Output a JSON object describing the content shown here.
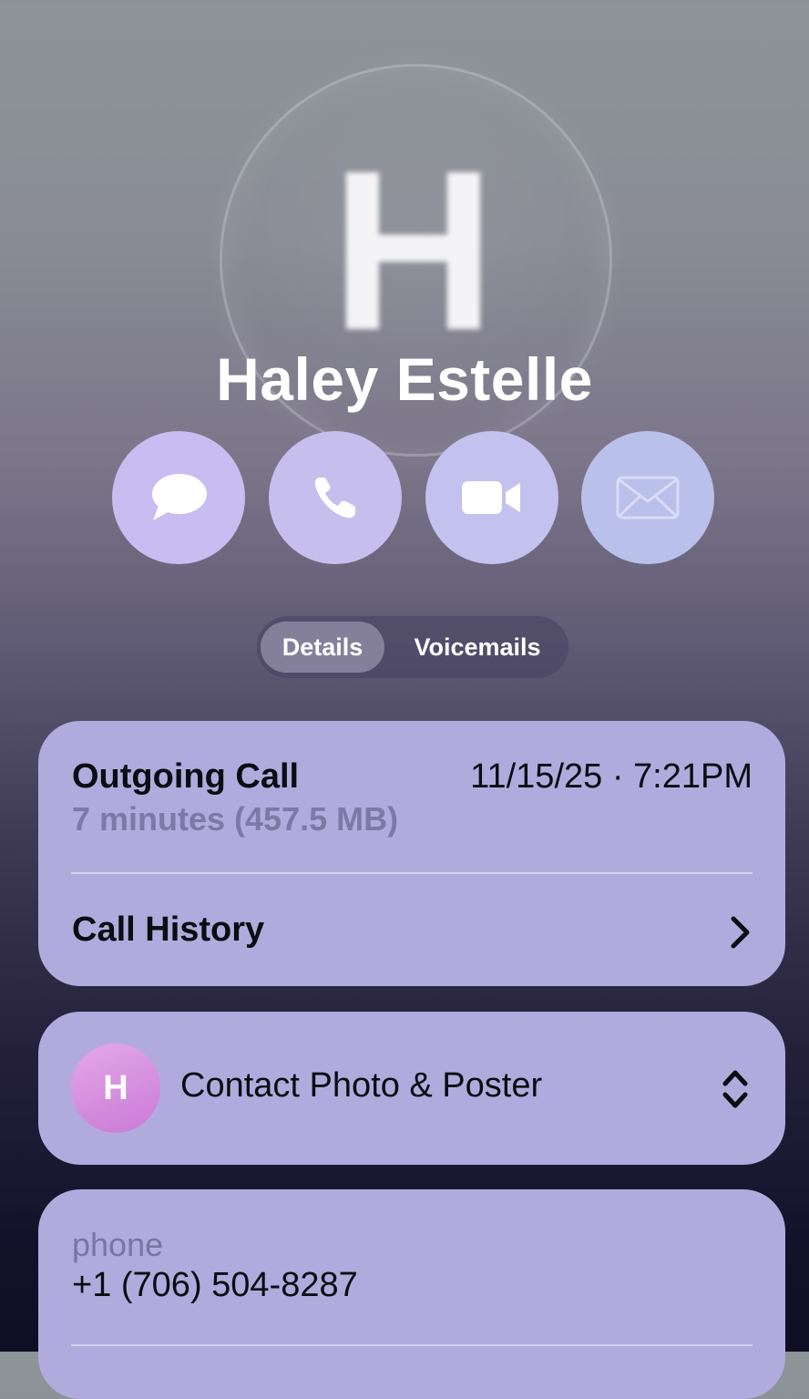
{
  "contact": {
    "monogram": "H",
    "name": "Haley Estelle"
  },
  "actions": [
    {
      "icon": "message-bubble-icon",
      "label": "message"
    },
    {
      "icon": "phone-icon",
      "label": "call"
    },
    {
      "icon": "video-camera-icon",
      "label": "video"
    },
    {
      "icon": "mail-icon",
      "label": "mail"
    }
  ],
  "tabs": {
    "details": "Details",
    "voicemails": "Voicemails",
    "selected": "Details"
  },
  "recent_call": {
    "type": "Outgoing Call",
    "datetime": "11/15/25 · 7:21PM",
    "detail": "7 minutes (457.5 MB)"
  },
  "call_history": {
    "label": "Call History"
  },
  "contact_photo": {
    "avatar_letter": "H",
    "label": "Contact Photo & Poster"
  },
  "phone": {
    "label": "phone",
    "number": "+1 (706) 504-8287"
  },
  "colors": {
    "card": "#b1abdd",
    "message_button": "#c8bdf0",
    "call_button": "#c6bfee",
    "video_button": "#c3c1ee",
    "mail_button": "#b9c0ea"
  }
}
